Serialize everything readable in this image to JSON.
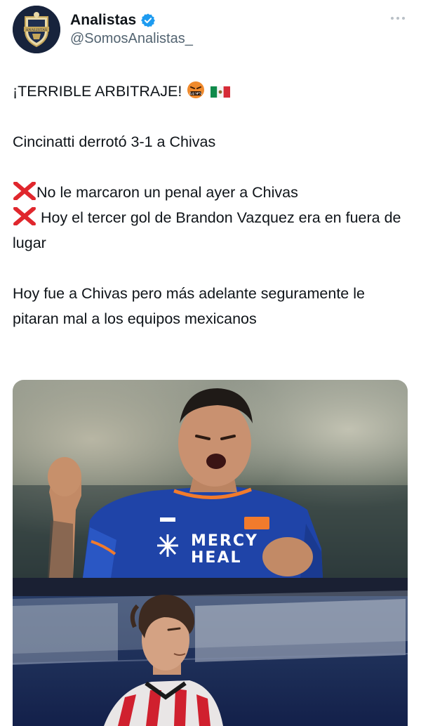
{
  "author": {
    "display_name": "Analistas",
    "handle": "@SomosAnalistas_",
    "avatar_icon": "analistas-shield-logo",
    "verified_icon": "verified-badge-icon",
    "verified_color": "#1d9bf0"
  },
  "more_icon": "more-options-icon",
  "tweet": {
    "line1": "¡TERRIBLE ARBITRAJE!",
    "line2": "Cincinatti derrotó 3-1 a Chivas",
    "line3": "No le marcaron un penal ayer a Chivas",
    "line4": " Hoy el tercer gol de Brandon Vazquez era en fuera de lugar",
    "line5": "Hoy fue a Chivas pero más adelante seguramente le pitaran mal a los equipos mexicanos"
  },
  "icons": {
    "angry": "angry-face-cursing-icon",
    "flag": "mexico-flag-icon",
    "cross": "red-cross-mark-icon"
  },
  "media": {
    "photo_top_text": "MERCY HEAL",
    "photo_top": "cincinnati-player-celebrating",
    "photo_bottom": "chivas-player-portrait"
  }
}
